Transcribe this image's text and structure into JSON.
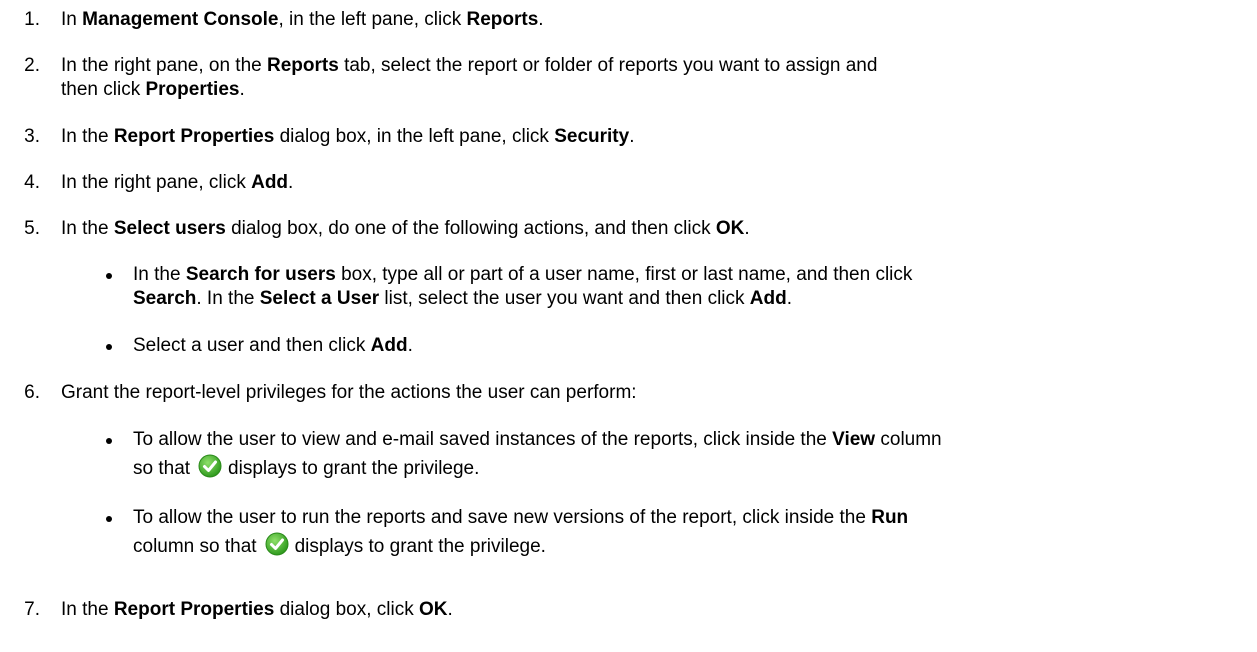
{
  "steps": [
    {
      "num": "1.",
      "parts": [
        "In ",
        "Management Console",
        ", in the left pane, click ",
        "Reports",
        "."
      ]
    },
    {
      "num": "2.",
      "line1": [
        "In the right pane, on the ",
        "Reports",
        " tab, select the report or folder of reports you want to assign and"
      ],
      "line2": [
        "then click ",
        "Properties",
        "."
      ]
    },
    {
      "num": "3.",
      "parts": [
        "In the ",
        "Report Properties",
        " dialog box, in the left pane, click ",
        "Security",
        "."
      ]
    },
    {
      "num": "4.",
      "parts": [
        "In the right pane, click ",
        "Add",
        "."
      ]
    },
    {
      "num": "5.",
      "parts": [
        "In the ",
        "Select users",
        " dialog box, do one of the following actions, and then click ",
        "OK",
        "."
      ],
      "bullets": [
        {
          "line1": [
            "In the ",
            "Search for users",
            " box, type all or part of a user name, first or last name, and then click"
          ],
          "line2": [
            "Search",
            ". In the ",
            "Select a User",
            " list, select the user you want and then click ",
            "Add",
            "."
          ]
        },
        {
          "parts": [
            "Select a user and then click ",
            "Add",
            "."
          ]
        }
      ]
    },
    {
      "num": "6.",
      "parts": [
        "Grant the report-level privileges for the actions the user can perform:"
      ],
      "bullets": [
        {
          "line1": [
            "To allow the user to view and e-mail saved instances of the reports, click inside the ",
            "View",
            " column"
          ],
          "line2": [
            "so that",
            "displays to grant the privilege."
          ],
          "icon": "green-check-icon"
        },
        {
          "line1": [
            "To allow the user to run the reports and save new versions of the report, click inside the ",
            "Run"
          ],
          "line2": [
            "column so that",
            "displays to grant the privilege."
          ],
          "icon": "green-check-icon"
        }
      ]
    },
    {
      "num": "7.",
      "parts": [
        "In the ",
        "Report Properties",
        " dialog box, click ",
        "OK",
        "."
      ]
    }
  ],
  "colors": {
    "text": "#000000",
    "check_green": "#3fae2a"
  }
}
